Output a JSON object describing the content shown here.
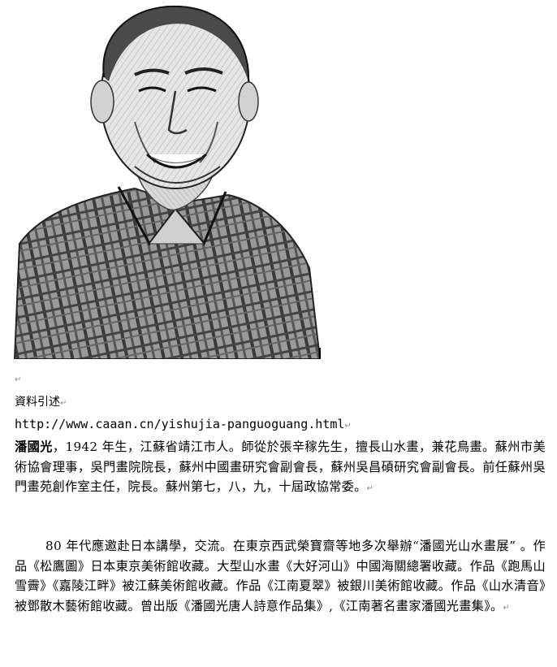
{
  "portrait": {
    "alt": "portrait-sketch"
  },
  "source": {
    "label": "資料引述",
    "url": "http://www.caaan.cn/yishujia-panguoguang.html"
  },
  "marks": {
    "paragraph": "↵"
  },
  "bio": {
    "name": "潘國光",
    "para1_rest": "，1942 年生，江蘇省靖江市人。師從於張辛稼先生，擅長山水畫，兼花鳥畫。蘇州市美術協會理事，吳門畫院院長，蘇州中國畫研究會副會長，蘇州吳昌碩研究會副會長。前任蘇州吳門畫苑創作室主任，院長。蘇州第七，八，九，十屆政協常委。",
    "para2": "80 年代應邀赴日本講學，交流。在東京西武榮寶齋等地多次舉辦“潘國光山水畫展” 。作品《松鷹圖》日本東京美術館收藏。大型山水畫《大好河山》中國海關總署收藏。作品《跑馬山雪霽》《嘉陵江畔》被江蘇美術館收藏。作品《江南夏翠》被銀川美術館收藏。作品《山水清音》被鄧散木藝術館收藏。曾出版《潘國光唐人詩意作品集》,《江南著名畫家潘國光畫集》。"
  }
}
